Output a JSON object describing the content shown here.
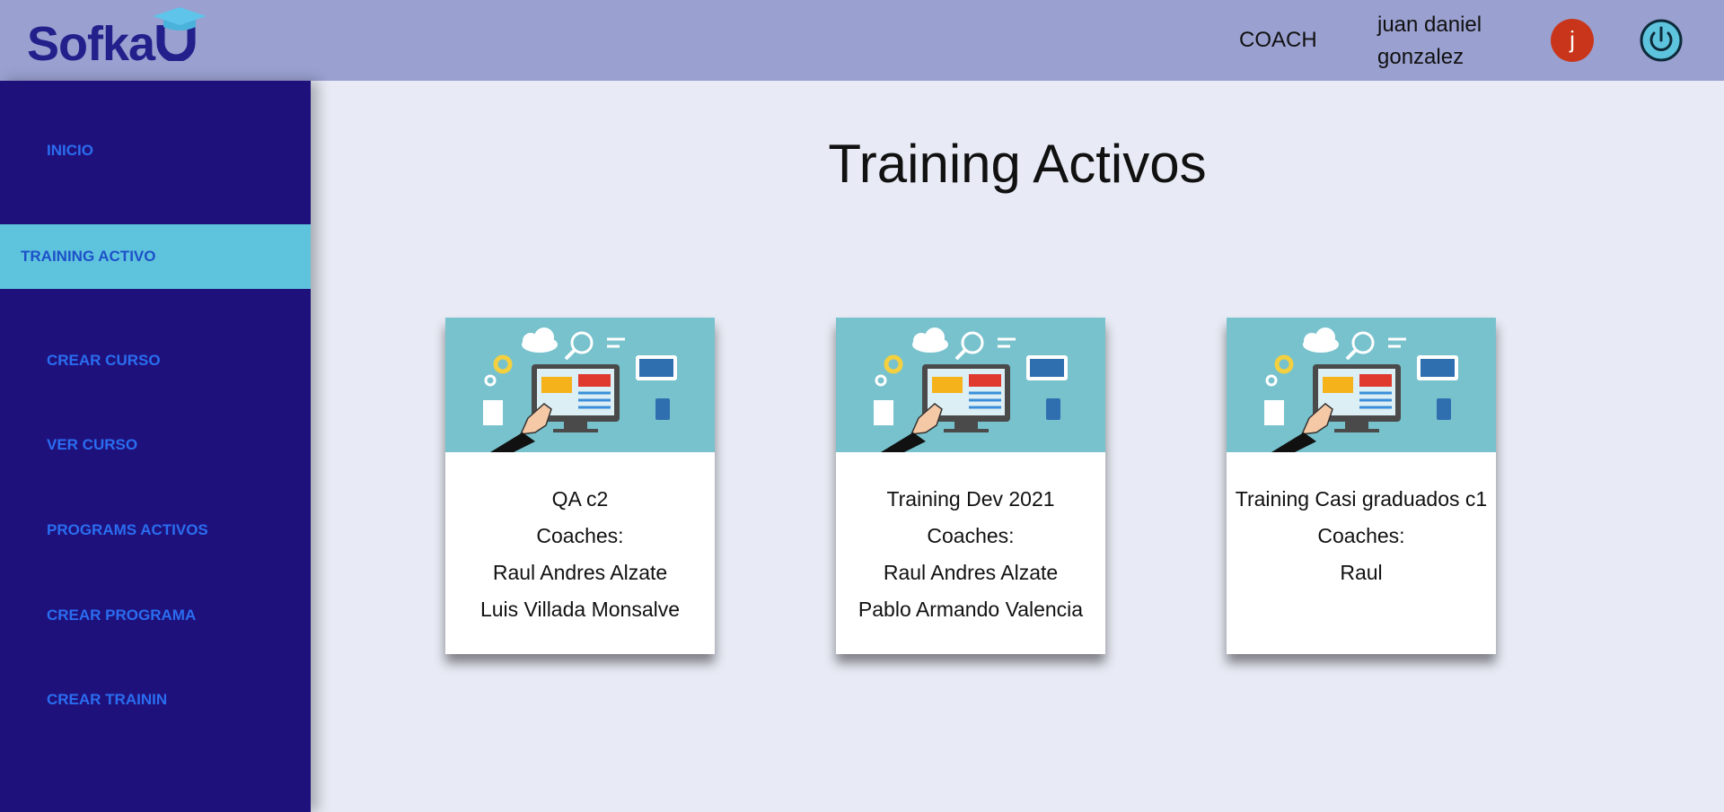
{
  "header": {
    "logo_text": "Sofka",
    "logo_letter": "U",
    "role": "COACH",
    "user_name": "juan daniel gonzalez",
    "avatar_initial": "j"
  },
  "sidebar": {
    "items": [
      {
        "label": "INICIO",
        "active": false
      },
      {
        "label": "TRAINING ACTIVO",
        "active": true
      },
      {
        "label": "CREAR CURSO",
        "active": false
      },
      {
        "label": "VER CURSO",
        "active": false
      },
      {
        "label": "PROGRAMS ACTIVOS",
        "active": false
      },
      {
        "label": "CREAR PROGRAMA",
        "active": false
      },
      {
        "label": "CREAR TRAININ",
        "active": false
      }
    ]
  },
  "main": {
    "title": "Training Activos",
    "cards": [
      {
        "name": "QA c2",
        "coaches_label": "Coaches:",
        "coaches": [
          "Raul Andres Alzate",
          "Luis Villada Monsalve"
        ]
      },
      {
        "name": "Training Dev 2021",
        "coaches_label": "Coaches:",
        "coaches": [
          "Raul Andres Alzate",
          "Pablo Armando Valencia"
        ]
      },
      {
        "name": "Training Casi graduados c1",
        "coaches_label": "Coaches:",
        "coaches": [
          "Raul"
        ]
      }
    ]
  },
  "colors": {
    "header_bg": "#9aa0cf",
    "sidebar_bg": "#1f117c",
    "active_item_bg": "#5ec4dd",
    "nav_text": "#2a6df0",
    "avatar_bg": "#c9351a",
    "card_image_bg": "#78c2cd"
  },
  "icons": {
    "power": "power-icon",
    "card_image": "computer-illustration"
  }
}
